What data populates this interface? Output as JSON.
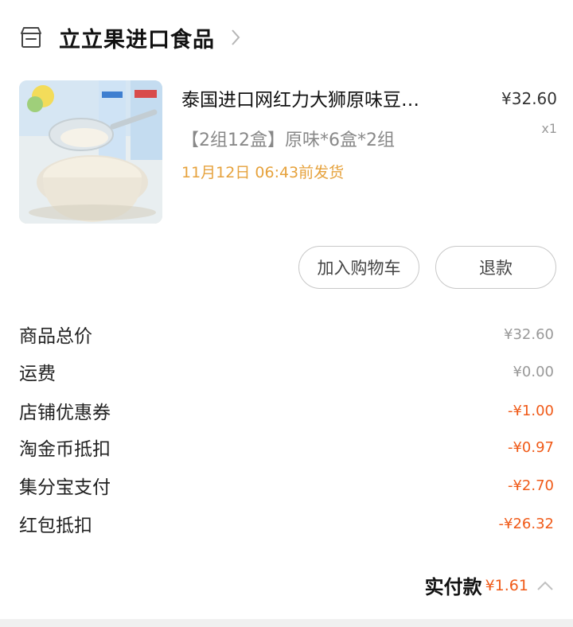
{
  "shop": {
    "name": "立立果进口食品",
    "icon": "store-icon",
    "chevron": "chevron-right-icon"
  },
  "product": {
    "title": "泰国进口网红力大狮原味豆…",
    "price": "¥32.60",
    "sku": "【2组12盒】原味*6盒*2组",
    "quantity": "x1",
    "ship_time": "11月12日 06:43前发货",
    "ship_color": "#e6a23c"
  },
  "actions": {
    "add_to_cart": "加入购物车",
    "refund": "退款"
  },
  "summary": [
    {
      "label": "商品总价",
      "value": "¥32.60"
    },
    {
      "label": "运费",
      "value": "¥0.00"
    },
    {
      "label": "店铺优惠券",
      "value": "-¥1.00"
    },
    {
      "label": "淘金币抵扣",
      "value": "-¥0.97"
    },
    {
      "label": "集分宝支付",
      "value": "-¥2.70"
    },
    {
      "label": "红包抵扣",
      "value": "-¥26.32"
    }
  ],
  "total": {
    "label": "实付款",
    "value": "¥1.61",
    "chevron": "chevron-up-icon"
  },
  "colors": {
    "accent": "#f05a18",
    "muted": "#999999"
  }
}
